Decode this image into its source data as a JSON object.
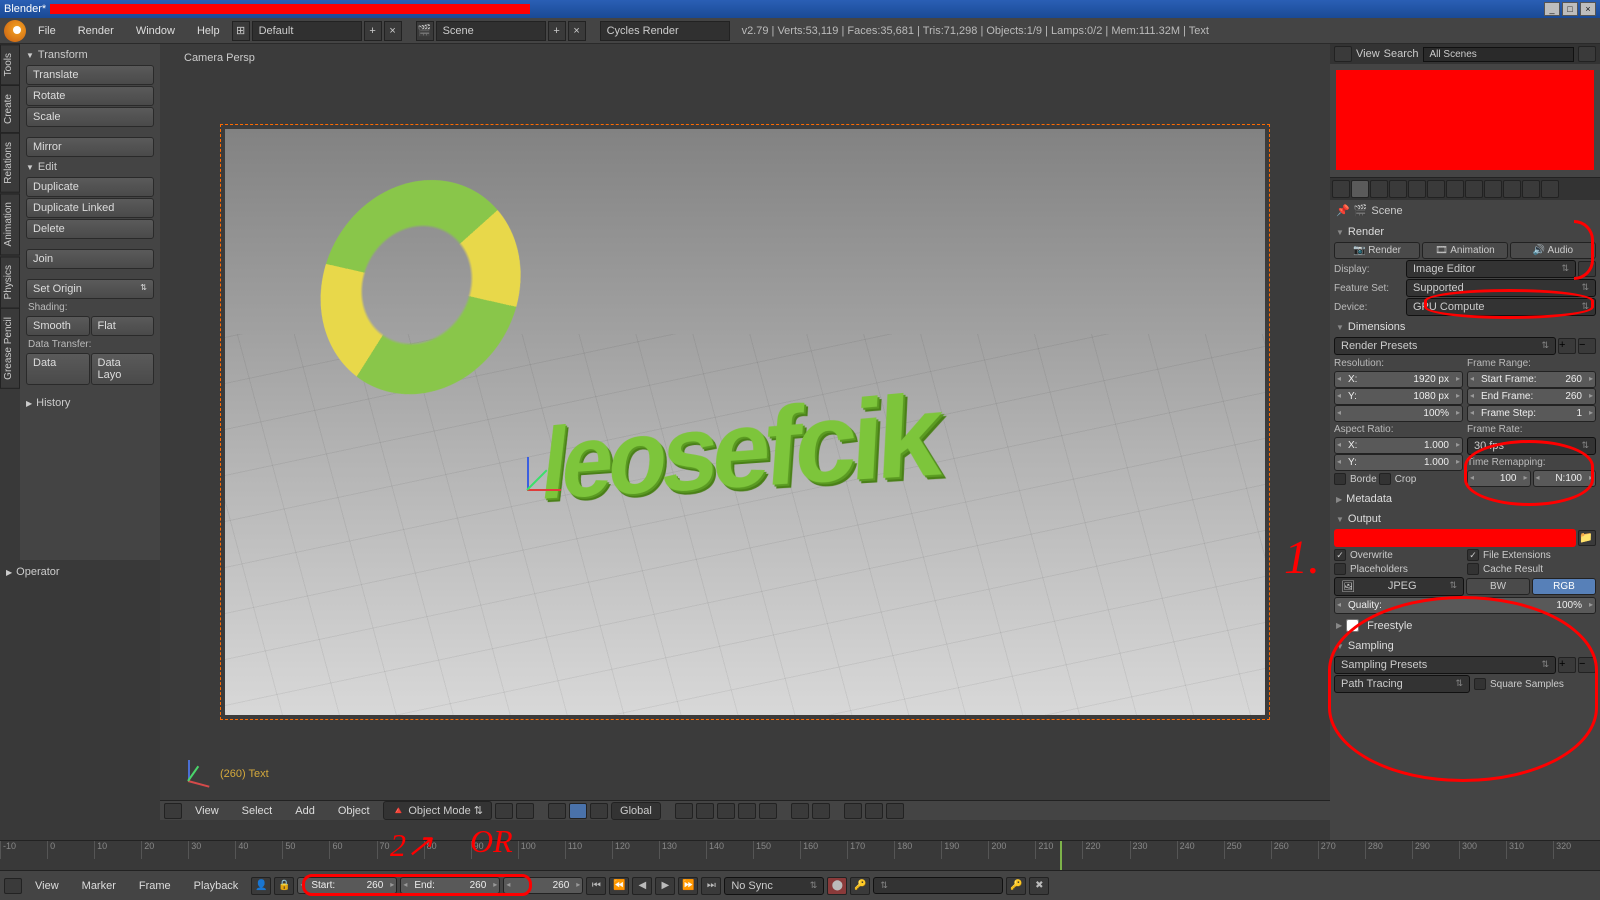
{
  "titlebar": {
    "app": "Blender"
  },
  "menubar": {
    "items": [
      "File",
      "Render",
      "Window",
      "Help"
    ],
    "layout": "Default",
    "scene": "Scene",
    "engine": "Cycles Render",
    "stats": "v2.79 | Verts:53,119 | Faces:35,681 | Tris:71,298 | Objects:1/9 | Lamps:0/2 | Mem:111.32M | Text"
  },
  "vtabs": [
    "Tools",
    "Create",
    "Relations",
    "Animation",
    "Physics",
    "Grease Pencil"
  ],
  "toolpanel": {
    "transform": {
      "title": "Transform",
      "translate": "Translate",
      "rotate": "Rotate",
      "scale": "Scale",
      "mirror": "Mirror"
    },
    "edit": {
      "title": "Edit",
      "duplicate": "Duplicate",
      "dup_linked": "Duplicate Linked",
      "delete": "Delete",
      "join": "Join",
      "set_origin": "Set Origin"
    },
    "shading_label": "Shading:",
    "smooth": "Smooth",
    "flat": "Flat",
    "datatx_label": "Data Transfer:",
    "data": "Data",
    "data_layout": "Data Layo",
    "history": "History"
  },
  "operator": "Operator",
  "viewport": {
    "camera_label": "Camera Persp",
    "text3d": "leosefcik",
    "frame_info": "(260) Text"
  },
  "vp_header": {
    "view": "View",
    "select": "Select",
    "add": "Add",
    "object": "Object",
    "mode": "Object Mode",
    "orientation": "Global"
  },
  "outliner": {
    "view": "View",
    "search": "Search",
    "filter": "All Scenes"
  },
  "properties": {
    "crumb": "Scene",
    "render": {
      "title": "Render",
      "render_btn": "Render",
      "anim_btn": "Animation",
      "audio_btn": "Audio",
      "display_label": "Display:",
      "display": "Image Editor",
      "feature_label": "Feature Set:",
      "feature": "Supported",
      "device_label": "Device:",
      "device": "GPU Compute"
    },
    "dimensions": {
      "title": "Dimensions",
      "presets": "Render Presets",
      "resolution_label": "Resolution:",
      "res_x_label": "X:",
      "res_x": "1920 px",
      "res_y_label": "Y:",
      "res_y": "1080 px",
      "res_pct": "100%",
      "aspect_label": "Aspect Ratio:",
      "asp_x_label": "X:",
      "asp_x": "1.000",
      "asp_y_label": "Y:",
      "asp_y": "1.000",
      "border": "Borde",
      "crop": "Crop",
      "frame_range_label": "Frame Range:",
      "start_label": "Start Frame:",
      "start": "260",
      "end_label": "End Frame:",
      "end": "260",
      "step_label": "Frame Step:",
      "step": "1",
      "rate_label": "Frame Rate:",
      "rate": "30 fps",
      "remap_label": "Time Remapping:",
      "remap_old": "100",
      "remap_new": "N:100"
    },
    "metadata": "Metadata",
    "output": {
      "title": "Output",
      "overwrite": "Overwrite",
      "file_ext": "File Extensions",
      "placeholders": "Placeholders",
      "cache": "Cache Result",
      "format": "JPEG",
      "bw": "BW",
      "rgb": "RGB",
      "quality_label": "Quality:",
      "quality": "100%"
    },
    "freestyle": "Freestyle",
    "sampling": {
      "title": "Sampling",
      "presets": "Sampling Presets",
      "integrator": "Path Tracing",
      "square": "Square Samples"
    }
  },
  "timeline": {
    "view": "View",
    "marker": "Marker",
    "frame": "Frame",
    "playback": "Playback",
    "start_label": "Start:",
    "start": "260",
    "end_label": "End:",
    "end": "260",
    "current": "260",
    "sync": "No Sync",
    "ticks": [
      "-10",
      "0",
      "10",
      "20",
      "30",
      "40",
      "50",
      "60",
      "70",
      "80",
      "90",
      "100",
      "110",
      "120",
      "130",
      "140",
      "150",
      "160",
      "170",
      "180",
      "190",
      "200",
      "210",
      "220",
      "230",
      "240",
      "250",
      "260",
      "270",
      "280",
      "290",
      "300",
      "310",
      "320"
    ]
  },
  "annotations": {
    "num1": "1.",
    "or": "OR",
    "num2_arrow": "2↗"
  }
}
